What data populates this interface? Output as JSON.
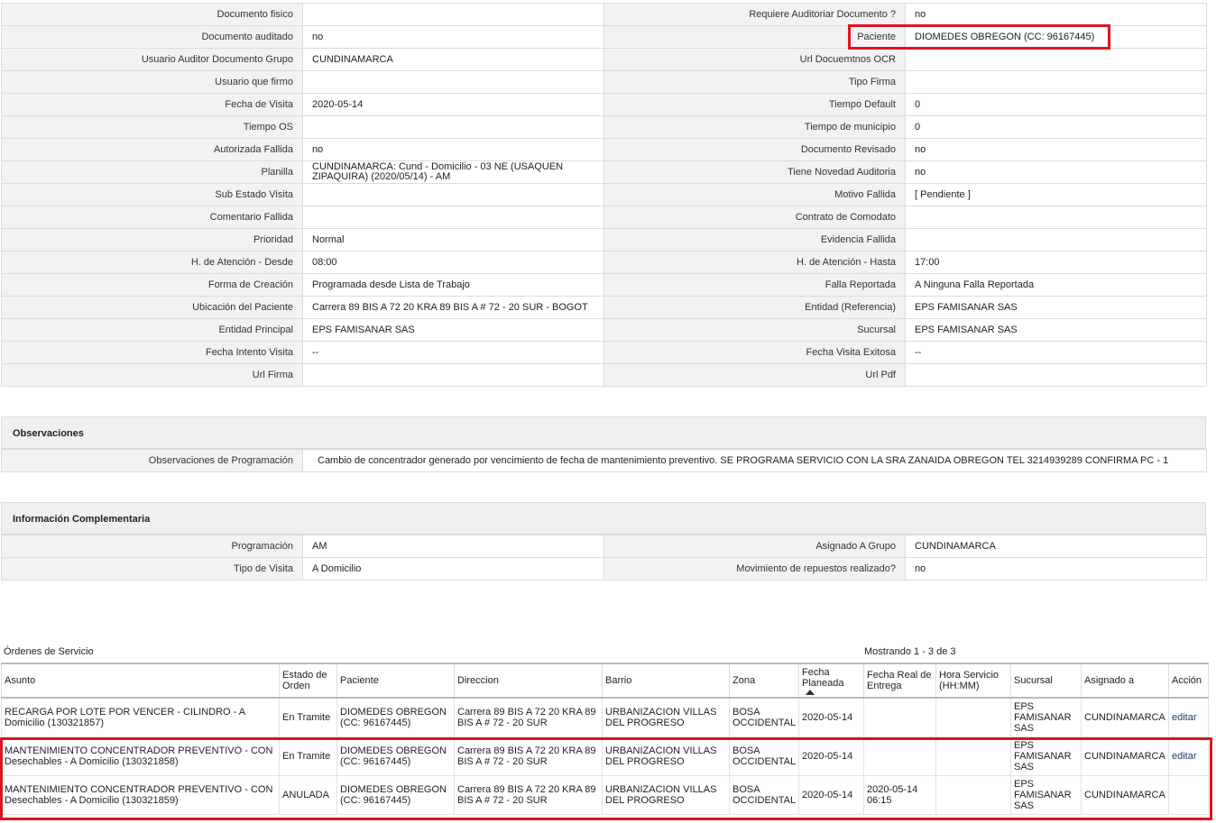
{
  "detail_rows": [
    {
      "l1": "Documento fisico",
      "v1": "",
      "l2": "Requiere Auditoriar Documento ?",
      "v2": "no"
    },
    {
      "l1": "Documento auditado",
      "v1": "no",
      "l2": "Paciente",
      "v2": "DIOMEDES OBREGON (CC: 96167445)"
    },
    {
      "l1": "Usuario Auditor Documento Grupo",
      "v1": "CUNDINAMARCA",
      "l2": "Url Docuemtnos OCR",
      "v2": ""
    },
    {
      "l1": "Usuario que firmo",
      "v1": "",
      "l2": "Tipo Firma",
      "v2": ""
    },
    {
      "l1": "Fecha de Visita",
      "v1": "2020-05-14",
      "l2": "Tiempo Default",
      "v2": "0"
    },
    {
      "l1": "Tiempo OS",
      "v1": "",
      "l2": "Tiempo de municipio",
      "v2": "0"
    },
    {
      "l1": "Autorizada Fallida",
      "v1": "no",
      "l2": "Documento Revisado",
      "v2": "no"
    },
    {
      "l1": "Planilla",
      "v1": "CUNDINAMARCA: Cund - Domicilio - 03 NE (USAQUEN ZIPAQUIRA) (2020/05/14) - AM",
      "l2": "Tiene Novedad Auditoria",
      "v2": "no"
    },
    {
      "l1": "Sub Estado Visita",
      "v1": "",
      "l2": "Motivo Fallida",
      "v2": "[ Pendiente ]"
    },
    {
      "l1": "Comentario Fallida",
      "v1": "",
      "l2": "Contrato de Comodato",
      "v2": ""
    },
    {
      "l1": "Prioridad",
      "v1": "Normal",
      "l2": "Evidencia Fallida",
      "v2": ""
    },
    {
      "l1": "H. de Atención - Desde",
      "v1": "08:00",
      "l2": "H. de Atención - Hasta",
      "v2": "17:00"
    },
    {
      "l1": "Forma de Creación",
      "v1": "Programada desde Lista de Trabajo",
      "l2": "Falla Reportada",
      "v2": "A Ninguna Falla Reportada"
    },
    {
      "l1": "Ubicación del Paciente",
      "v1": "Carrera 89 BIS A 72 20 KRA 89 BIS A # 72 - 20 SUR - BOGOT",
      "l2": "Entidad (Referencia)",
      "v2": "EPS FAMISANAR SAS"
    },
    {
      "l1": "Entidad Principal",
      "v1": "EPS FAMISANAR SAS",
      "l2": "Sucursal",
      "v2": "EPS FAMISANAR SAS"
    },
    {
      "l1": "Fecha Intento Visita",
      "v1": "--",
      "l2": "Fecha Visita Exitosa",
      "v2": "--"
    },
    {
      "l1": "Url Firma",
      "v1": "",
      "l2": "Url Pdf",
      "v2": ""
    }
  ],
  "observaciones": {
    "title": "Observaciones",
    "label": "Observaciones de Programación",
    "value": "Cambio de concentrador generado por vencimiento de fecha de mantenimiento preventivo. SE PROGRAMA SERVICIO CON LA SRA ZANAIDA OBREGON TEL 3214939289 CONFIRMA PC - 1"
  },
  "complementaria": {
    "title": "Información Complementaria",
    "rows": [
      {
        "l1": "Programación",
        "v1": "AM",
        "l2": "Asignado A Grupo",
        "v2": "CUNDINAMARCA"
      },
      {
        "l1": "Tipo de Visita",
        "v1": "A Domicilio",
        "l2": "Movimiento de repuestos realizado?",
        "v2": "no"
      }
    ]
  },
  "orders": {
    "title": "Órdenes de Servicio",
    "count": "Mostrando 1 - 3 de 3",
    "headers": [
      "Asunto",
      "Estado de Orden",
      "Paciente",
      "Direccion",
      "Barrio",
      "Zona",
      "Fecha Planeada",
      "Fecha Real de Entrega",
      "Hora Servicio (HH:MM)",
      "Sucursal",
      "Asignado a",
      "Acción"
    ],
    "rows": [
      {
        "asunto": "RECARGA POR LOTE POR VENCER - CILINDRO - A Domicilio (130321857)",
        "estado": "En Tramite",
        "paciente": "DIOMEDES OBREGON (CC: 96167445)",
        "direccion": "Carrera 89 BIS A 72 20 KRA 89 BIS A # 72 - 20 SUR",
        "barrio": "URBANIZACION VILLAS DEL PROGRESO",
        "zona": "BOSA OCCIDENTAL",
        "fecha_planeada": "2020-05-14",
        "fecha_real": "",
        "hora": "",
        "sucursal": "EPS FAMISANAR SAS",
        "asignado": "CUNDINAMARCA",
        "accion": "editar"
      },
      {
        "asunto": "MANTENIMIENTO CONCENTRADOR PREVENTIVO - CON Desechables - A Domicilio (130321858)",
        "estado": "En Tramite",
        "paciente": "DIOMEDES OBREGON (CC: 96167445)",
        "direccion": "Carrera 89 BIS A 72 20 KRA 89 BIS A # 72 - 20 SUR",
        "barrio": "URBANIZACION VILLAS DEL PROGRESO",
        "zona": "BOSA OCCIDENTAL",
        "fecha_planeada": "2020-05-14",
        "fecha_real": "",
        "hora": "",
        "sucursal": "EPS FAMISANAR SAS",
        "asignado": "CUNDINAMARCA",
        "accion": "editar"
      },
      {
        "asunto": "MANTENIMIENTO CONCENTRADOR PREVENTIVO - CON Desechables - A Domicilio (130321859)",
        "estado": "ANULADA",
        "paciente": "DIOMEDES OBREGON (CC: 96167445)",
        "direccion": "Carrera 89 BIS A 72 20 KRA 89 BIS A # 72 - 20 SUR",
        "barrio": "URBANIZACION VILLAS DEL PROGRESO",
        "zona": "BOSA OCCIDENTAL",
        "fecha_planeada": "2020-05-14",
        "fecha_real": "2020-05-14 06:15",
        "hora": "",
        "sucursal": "EPS FAMISANAR SAS",
        "asignado": "CUNDINAMARCA",
        "accion": ""
      }
    ]
  },
  "colors": {
    "highlight": "#e0141e",
    "label_bg": "#f2f2f2",
    "link": "#1a3d6e"
  }
}
